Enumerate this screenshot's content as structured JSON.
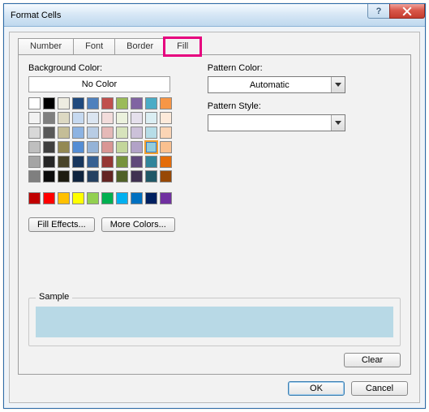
{
  "window": {
    "title": "Format Cells"
  },
  "tabs": {
    "number": "Number",
    "font": "Font",
    "border": "Border",
    "fill": "Fill"
  },
  "fill": {
    "bg_label": "Background Color:",
    "no_color": "No Color",
    "fill_effects": "Fill Effects...",
    "more_colors": "More Colors...",
    "pattern_color_label": "Pattern Color:",
    "pattern_color_value": "Automatic",
    "pattern_style_label": "Pattern Style:",
    "sample_label": "Sample",
    "sample_color": "#b8d9e6",
    "theme_colors": [
      "#ffffff",
      "#000000",
      "#eeece1",
      "#1f497d",
      "#4f81bd",
      "#c0504d",
      "#9bbb59",
      "#8064a2",
      "#4bacc6",
      "#f79646",
      "#f2f2f2",
      "#7f7f7f",
      "#ddd9c3",
      "#c6d9f0",
      "#dbe5f1",
      "#f2dcdb",
      "#ebf1dd",
      "#e5e0ec",
      "#dbeef3",
      "#fdeada",
      "#d8d8d8",
      "#595959",
      "#c4bd97",
      "#8db3e2",
      "#b8cce4",
      "#e5b9b7",
      "#d7e3bc",
      "#ccc1d9",
      "#b7dde8",
      "#fbd5b5",
      "#bfbfbf",
      "#3f3f3f",
      "#938953",
      "#548dd4",
      "#95b3d7",
      "#d99694",
      "#c3d69b",
      "#b2a2c7",
      "#92cddc",
      "#fac08f",
      "#a5a5a5",
      "#262626",
      "#494429",
      "#17365d",
      "#366092",
      "#953734",
      "#76923c",
      "#5f497a",
      "#31859b",
      "#e36c09",
      "#7f7f7f",
      "#0c0c0c",
      "#1d1b10",
      "#0f243e",
      "#244061",
      "#632423",
      "#4f6128",
      "#3f3151",
      "#205867",
      "#974806"
    ],
    "standard_colors": [
      "#c00000",
      "#ff0000",
      "#ffc000",
      "#ffff00",
      "#92d050",
      "#00b050",
      "#00b0f0",
      "#0070c0",
      "#002060",
      "#7030a0"
    ],
    "selected_index": 38
  },
  "buttons": {
    "clear": "Clear",
    "ok": "OK",
    "cancel": "Cancel"
  }
}
